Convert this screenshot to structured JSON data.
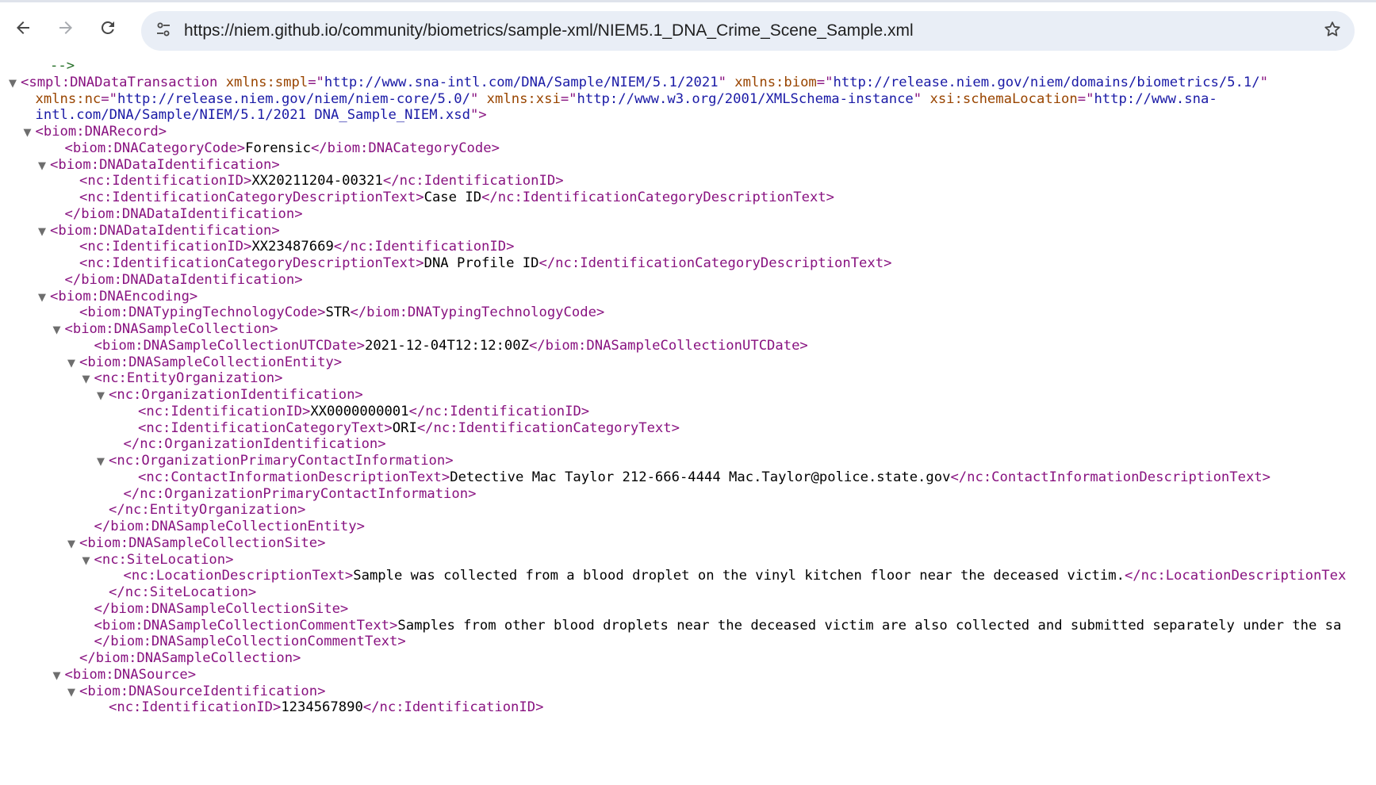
{
  "browser": {
    "url": "https://niem.github.io/community/biometrics/sample-xml/NIEM5.1_DNA_Crime_Scene_Sample.xml",
    "icons": {
      "back": "back-arrow-icon",
      "forward": "forward-arrow-icon",
      "reload": "reload-icon",
      "site_info": "tune-icon",
      "bookmark": "star-icon"
    }
  },
  "xml": {
    "lines": [
      {
        "i": 2,
        "t": "",
        "s": [
          [
            "cm",
            "-->"
          ]
        ]
      },
      {
        "i": 0,
        "t": "▼",
        "s": [
          [
            "tg",
            "<smpl:DNADataTransaction "
          ],
          [
            "an",
            "xmlns:smpl"
          ],
          [
            "tg",
            "=\""
          ],
          [
            "av",
            "http://www.sna-intl.com/DNA/Sample/NIEM/5.1/2021"
          ],
          [
            "tg",
            "\" "
          ],
          [
            "an",
            "xmlns:biom"
          ],
          [
            "tg",
            "=\""
          ],
          [
            "av",
            "http://release.niem.gov/niem/domains/biometrics/5.1/"
          ],
          [
            "tg",
            "\""
          ]
        ]
      },
      {
        "i": 1,
        "t": "",
        "s": [
          [
            "an",
            "xmlns:nc"
          ],
          [
            "tg",
            "=\""
          ],
          [
            "av",
            "http://release.niem.gov/niem/niem-core/5.0/"
          ],
          [
            "tg",
            "\" "
          ],
          [
            "an",
            "xmlns:xsi"
          ],
          [
            "tg",
            "=\""
          ],
          [
            "av",
            "http://www.w3.org/2001/XMLSchema-instance"
          ],
          [
            "tg",
            "\" "
          ],
          [
            "an",
            "xsi:schemaLocation"
          ],
          [
            "tg",
            "=\""
          ],
          [
            "av",
            "http://www.sna-"
          ]
        ]
      },
      {
        "i": 1,
        "t": "",
        "s": [
          [
            "av",
            "intl.com/DNA/Sample/NIEM/5.1/2021 DNA_Sample_NIEM.xsd"
          ],
          [
            "tg",
            "\">"
          ]
        ]
      },
      {
        "i": 1,
        "t": "▼",
        "s": [
          [
            "tg",
            "<biom:DNARecord>"
          ]
        ]
      },
      {
        "i": 3,
        "t": "",
        "s": [
          [
            "tg",
            "<biom:DNACategoryCode>"
          ],
          [
            "tx",
            "Forensic"
          ],
          [
            "tg",
            "</biom:DNACategoryCode>"
          ]
        ]
      },
      {
        "i": 2,
        "t": "▼",
        "s": [
          [
            "tg",
            "<biom:DNADataIdentification>"
          ]
        ]
      },
      {
        "i": 4,
        "t": "",
        "s": [
          [
            "tg",
            "<nc:IdentificationID>"
          ],
          [
            "tx",
            "XX20211204-00321"
          ],
          [
            "tg",
            "</nc:IdentificationID>"
          ]
        ]
      },
      {
        "i": 4,
        "t": "",
        "s": [
          [
            "tg",
            "<nc:IdentificationCategoryDescriptionText>"
          ],
          [
            "tx",
            "Case ID"
          ],
          [
            "tg",
            "</nc:IdentificationCategoryDescriptionText>"
          ]
        ]
      },
      {
        "i": 3,
        "t": "",
        "s": [
          [
            "tg",
            "</biom:DNADataIdentification>"
          ]
        ]
      },
      {
        "i": 2,
        "t": "▼",
        "s": [
          [
            "tg",
            "<biom:DNADataIdentification>"
          ]
        ]
      },
      {
        "i": 4,
        "t": "",
        "s": [
          [
            "tg",
            "<nc:IdentificationID>"
          ],
          [
            "tx",
            "XX23487669"
          ],
          [
            "tg",
            "</nc:IdentificationID>"
          ]
        ]
      },
      {
        "i": 4,
        "t": "",
        "s": [
          [
            "tg",
            "<nc:IdentificationCategoryDescriptionText>"
          ],
          [
            "tx",
            "DNA Profile ID"
          ],
          [
            "tg",
            "</nc:IdentificationCategoryDescriptionText>"
          ]
        ]
      },
      {
        "i": 3,
        "t": "",
        "s": [
          [
            "tg",
            "</biom:DNADataIdentification>"
          ]
        ]
      },
      {
        "i": 2,
        "t": "▼",
        "s": [
          [
            "tg",
            "<biom:DNAEncoding>"
          ]
        ]
      },
      {
        "i": 4,
        "t": "",
        "s": [
          [
            "tg",
            "<biom:DNATypingTechnologyCode>"
          ],
          [
            "tx",
            "STR"
          ],
          [
            "tg",
            "</biom:DNATypingTechnologyCode>"
          ]
        ]
      },
      {
        "i": 3,
        "t": "▼",
        "s": [
          [
            "tg",
            "<biom:DNASampleCollection>"
          ]
        ]
      },
      {
        "i": 5,
        "t": "",
        "s": [
          [
            "tg",
            "<biom:DNASampleCollectionUTCDate>"
          ],
          [
            "tx",
            "2021-12-04T12:12:00Z"
          ],
          [
            "tg",
            "</biom:DNASampleCollectionUTCDate>"
          ]
        ]
      },
      {
        "i": 4,
        "t": "▼",
        "s": [
          [
            "tg",
            "<biom:DNASampleCollectionEntity>"
          ]
        ]
      },
      {
        "i": 5,
        "t": "▼",
        "s": [
          [
            "tg",
            "<nc:EntityOrganization>"
          ]
        ]
      },
      {
        "i": 6,
        "t": "▼",
        "s": [
          [
            "tg",
            "<nc:OrganizationIdentification>"
          ]
        ]
      },
      {
        "i": 8,
        "t": "",
        "s": [
          [
            "tg",
            "<nc:IdentificationID>"
          ],
          [
            "tx",
            "XX0000000001"
          ],
          [
            "tg",
            "</nc:IdentificationID>"
          ]
        ]
      },
      {
        "i": 8,
        "t": "",
        "s": [
          [
            "tg",
            "<nc:IdentificationCategoryText>"
          ],
          [
            "tx",
            "ORI"
          ],
          [
            "tg",
            "</nc:IdentificationCategoryText>"
          ]
        ]
      },
      {
        "i": 7,
        "t": "",
        "s": [
          [
            "tg",
            "</nc:OrganizationIdentification>"
          ]
        ]
      },
      {
        "i": 6,
        "t": "▼",
        "s": [
          [
            "tg",
            "<nc:OrganizationPrimaryContactInformation>"
          ]
        ]
      },
      {
        "i": 8,
        "t": "",
        "s": [
          [
            "tg",
            "<nc:ContactInformationDescriptionText>"
          ],
          [
            "tx",
            "Detective Mac Taylor 212-666-4444 Mac.Taylor@police.state.gov"
          ],
          [
            "tg",
            "</nc:ContactInformationDescriptionText>"
          ]
        ]
      },
      {
        "i": 7,
        "t": "",
        "s": [
          [
            "tg",
            "</nc:OrganizationPrimaryContactInformation>"
          ]
        ]
      },
      {
        "i": 6,
        "t": "",
        "s": [
          [
            "tg",
            "</nc:EntityOrganization>"
          ]
        ]
      },
      {
        "i": 5,
        "t": "",
        "s": [
          [
            "tg",
            "</biom:DNASampleCollectionEntity>"
          ]
        ]
      },
      {
        "i": 4,
        "t": "▼",
        "s": [
          [
            "tg",
            "<biom:DNASampleCollectionSite>"
          ]
        ]
      },
      {
        "i": 5,
        "t": "▼",
        "s": [
          [
            "tg",
            "<nc:SiteLocation>"
          ]
        ]
      },
      {
        "i": 7,
        "t": "",
        "s": [
          [
            "tg",
            "<nc:LocationDescriptionText>"
          ],
          [
            "tx",
            "Sample was collected from a blood droplet on the vinyl kitchen floor near the deceased victim."
          ],
          [
            "tg",
            "</nc:LocationDescriptionTex"
          ]
        ]
      },
      {
        "i": 6,
        "t": "",
        "s": [
          [
            "tg",
            "</nc:SiteLocation>"
          ]
        ]
      },
      {
        "i": 5,
        "t": "",
        "s": [
          [
            "tg",
            "</biom:DNASampleCollectionSite>"
          ]
        ]
      },
      {
        "i": 5,
        "t": "",
        "s": [
          [
            "tg",
            "<biom:DNASampleCollectionCommentText>"
          ],
          [
            "tx",
            "Samples from other blood droplets near the deceased victim are also collected and submitted separately under the sa"
          ]
        ]
      },
      {
        "i": 5,
        "t": "",
        "s": [
          [
            "tg",
            "</biom:DNASampleCollectionCommentText>"
          ]
        ]
      },
      {
        "i": 4,
        "t": "",
        "s": [
          [
            "tg",
            "</biom:DNASampleCollection>"
          ]
        ]
      },
      {
        "i": 3,
        "t": "▼",
        "s": [
          [
            "tg",
            "<biom:DNASource>"
          ]
        ]
      },
      {
        "i": 4,
        "t": "▼",
        "s": [
          [
            "tg",
            "<biom:DNASourceIdentification>"
          ]
        ]
      },
      {
        "i": 6,
        "t": "",
        "s": [
          [
            "tg",
            "<nc:IdentificationID>"
          ],
          [
            "tx",
            "1234567890"
          ],
          [
            "tg",
            "</nc:IdentificationID>"
          ]
        ]
      }
    ]
  }
}
